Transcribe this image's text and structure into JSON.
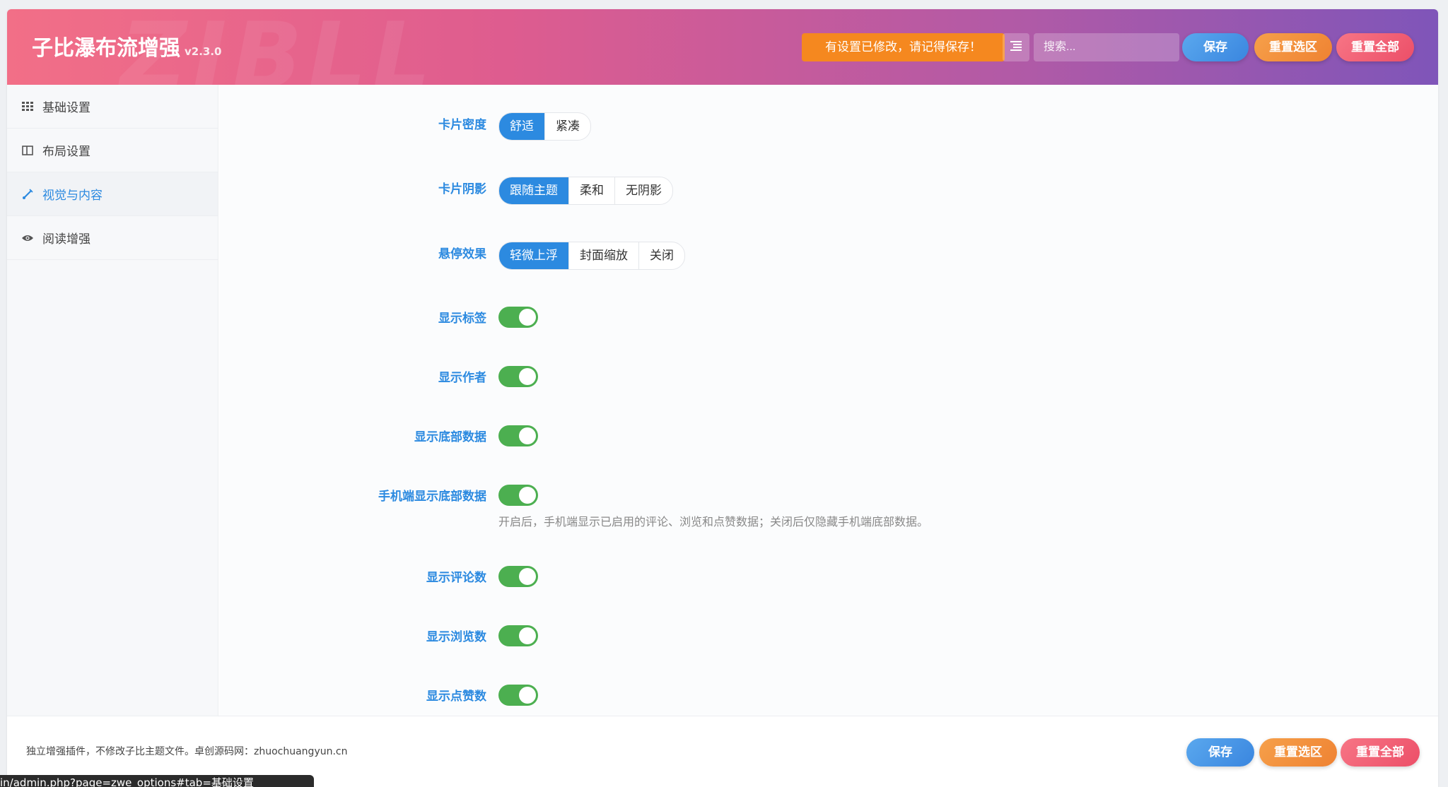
{
  "header": {
    "title": "子比瀑布流增强",
    "version": "v2.3.0",
    "watermark": "ZIBLL",
    "notice": "有设置已修改，请记得保存！",
    "search_placeholder": "搜索...",
    "buttons": {
      "save": "保存",
      "reset_section": "重置选区",
      "reset_all": "重置全部"
    }
  },
  "sidebar": {
    "items": [
      {
        "label": "基础设置",
        "icon": "grid-icon"
      },
      {
        "label": "布局设置",
        "icon": "columns-icon"
      },
      {
        "label": "视觉与内容",
        "icon": "brush-icon",
        "active": true
      },
      {
        "label": "阅读增强",
        "icon": "eye-icon"
      }
    ]
  },
  "settings": {
    "card_density": {
      "label": "卡片密度",
      "options": [
        "舒适",
        "紧凑"
      ],
      "selected": "舒适"
    },
    "card_shadow": {
      "label": "卡片阴影",
      "options": [
        "跟随主题",
        "柔和",
        "无阴影"
      ],
      "selected": "跟随主题"
    },
    "hover_effect": {
      "label": "悬停效果",
      "options": [
        "轻微上浮",
        "封面缩放",
        "关闭"
      ],
      "selected": "轻微上浮"
    },
    "show_tags": {
      "label": "显示标签",
      "on": true
    },
    "show_author": {
      "label": "显示作者",
      "on": true
    },
    "show_bottom_data": {
      "label": "显示底部数据",
      "on": true
    },
    "mobile_bottom_data": {
      "label": "手机端显示底部数据",
      "on": true,
      "desc": "开启后，手机端显示已启用的评论、浏览和点赞数据；关闭后仅隐藏手机端底部数据。"
    },
    "show_comments": {
      "label": "显示评论数",
      "on": true
    },
    "show_views": {
      "label": "显示浏览数",
      "on": true
    },
    "show_likes": {
      "label": "显示点赞数",
      "on": true
    }
  },
  "footer": {
    "text": "独立增强插件，不修改子比主题文件。卓创源码网：zhuochuangyun.cn",
    "buttons": {
      "save": "保存",
      "reset_section": "重置选区",
      "reset_all": "重置全部"
    }
  },
  "statusbar": {
    "url": "in/admin.php?page=zwe_options#tab=基础设置"
  },
  "colors": {
    "accent": "#2c8ae0",
    "toggle_on": "#4caf50",
    "notice": "#f5881f",
    "header_start": "#f26f87",
    "header_end": "#7f55b9"
  }
}
